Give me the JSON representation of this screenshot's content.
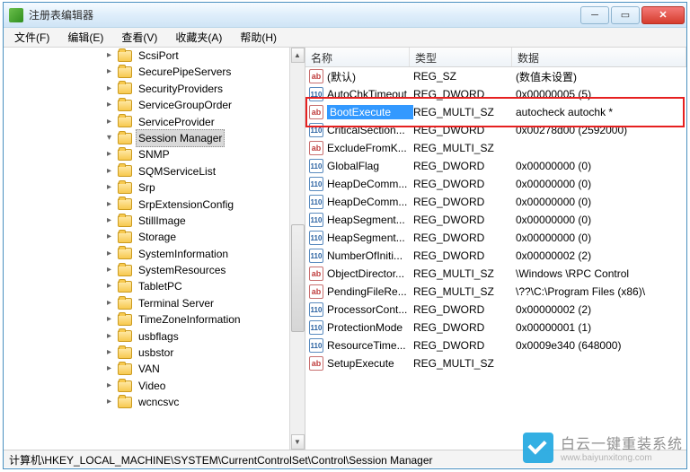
{
  "window": {
    "title": "注册表编辑器"
  },
  "menu": {
    "file": "文件(F)",
    "edit": "编辑(E)",
    "view": "查看(V)",
    "fav": "收藏夹(A)",
    "help": "帮助(H)"
  },
  "tree": {
    "items": [
      {
        "label": "ScsiPort"
      },
      {
        "label": "SecurePipeServers"
      },
      {
        "label": "SecurityProviders"
      },
      {
        "label": "ServiceGroupOrder"
      },
      {
        "label": "ServiceProvider"
      },
      {
        "label": "Session Manager",
        "selected": true,
        "open": true
      },
      {
        "label": "SNMP"
      },
      {
        "label": "SQMServiceList"
      },
      {
        "label": "Srp"
      },
      {
        "label": "SrpExtensionConfig"
      },
      {
        "label": "StillImage"
      },
      {
        "label": "Storage"
      },
      {
        "label": "SystemInformation"
      },
      {
        "label": "SystemResources"
      },
      {
        "label": "TabletPC"
      },
      {
        "label": "Terminal Server"
      },
      {
        "label": "TimeZoneInformation"
      },
      {
        "label": "usbflags"
      },
      {
        "label": "usbstor"
      },
      {
        "label": "VAN"
      },
      {
        "label": "Video"
      },
      {
        "label": "wcncsvc"
      }
    ]
  },
  "list": {
    "cols": {
      "name": "名称",
      "type": "类型",
      "data": "数据"
    },
    "rows": [
      {
        "icon": "ab",
        "name": "(默认)",
        "type": "REG_SZ",
        "data": "(数值未设置)"
      },
      {
        "icon": "bin",
        "name": "AutoChkTimeout",
        "type": "REG_DWORD",
        "data": "0x00000005 (5)"
      },
      {
        "icon": "ab",
        "name": "BootExecute",
        "type": "REG_MULTI_SZ",
        "data": "autocheck autochk *",
        "selected": true,
        "highlight": true
      },
      {
        "icon": "bin",
        "name": "CriticalSection...",
        "type": "REG_DWORD",
        "data": "0x00278d00 (2592000)"
      },
      {
        "icon": "ab",
        "name": "ExcludeFromK...",
        "type": "REG_MULTI_SZ",
        "data": ""
      },
      {
        "icon": "bin",
        "name": "GlobalFlag",
        "type": "REG_DWORD",
        "data": "0x00000000 (0)"
      },
      {
        "icon": "bin",
        "name": "HeapDeComm...",
        "type": "REG_DWORD",
        "data": "0x00000000 (0)"
      },
      {
        "icon": "bin",
        "name": "HeapDeComm...",
        "type": "REG_DWORD",
        "data": "0x00000000 (0)"
      },
      {
        "icon": "bin",
        "name": "HeapSegment...",
        "type": "REG_DWORD",
        "data": "0x00000000 (0)"
      },
      {
        "icon": "bin",
        "name": "HeapSegment...",
        "type": "REG_DWORD",
        "data": "0x00000000 (0)"
      },
      {
        "icon": "bin",
        "name": "NumberOfIniti...",
        "type": "REG_DWORD",
        "data": "0x00000002 (2)"
      },
      {
        "icon": "ab",
        "name": "ObjectDirector...",
        "type": "REG_MULTI_SZ",
        "data": "\\Windows \\RPC Control"
      },
      {
        "icon": "ab",
        "name": "PendingFileRe...",
        "type": "REG_MULTI_SZ",
        "data": "\\??\\C:\\Program Files (x86)\\"
      },
      {
        "icon": "bin",
        "name": "ProcessorCont...",
        "type": "REG_DWORD",
        "data": "0x00000002 (2)"
      },
      {
        "icon": "bin",
        "name": "ProtectionMode",
        "type": "REG_DWORD",
        "data": "0x00000001 (1)"
      },
      {
        "icon": "bin",
        "name": "ResourceTime...",
        "type": "REG_DWORD",
        "data": "0x0009e340 (648000)"
      },
      {
        "icon": "ab",
        "name": "SetupExecute",
        "type": "REG_MULTI_SZ",
        "data": ""
      }
    ]
  },
  "status": {
    "path": "计算机\\HKEY_LOCAL_MACHINE\\SYSTEM\\CurrentControlSet\\Control\\Session Manager"
  },
  "watermark": {
    "title": "白云一键重装系统",
    "sub": "www.baiyunxitong.com"
  },
  "icons": {
    "ab_text": "ab",
    "bin_text": "110"
  }
}
